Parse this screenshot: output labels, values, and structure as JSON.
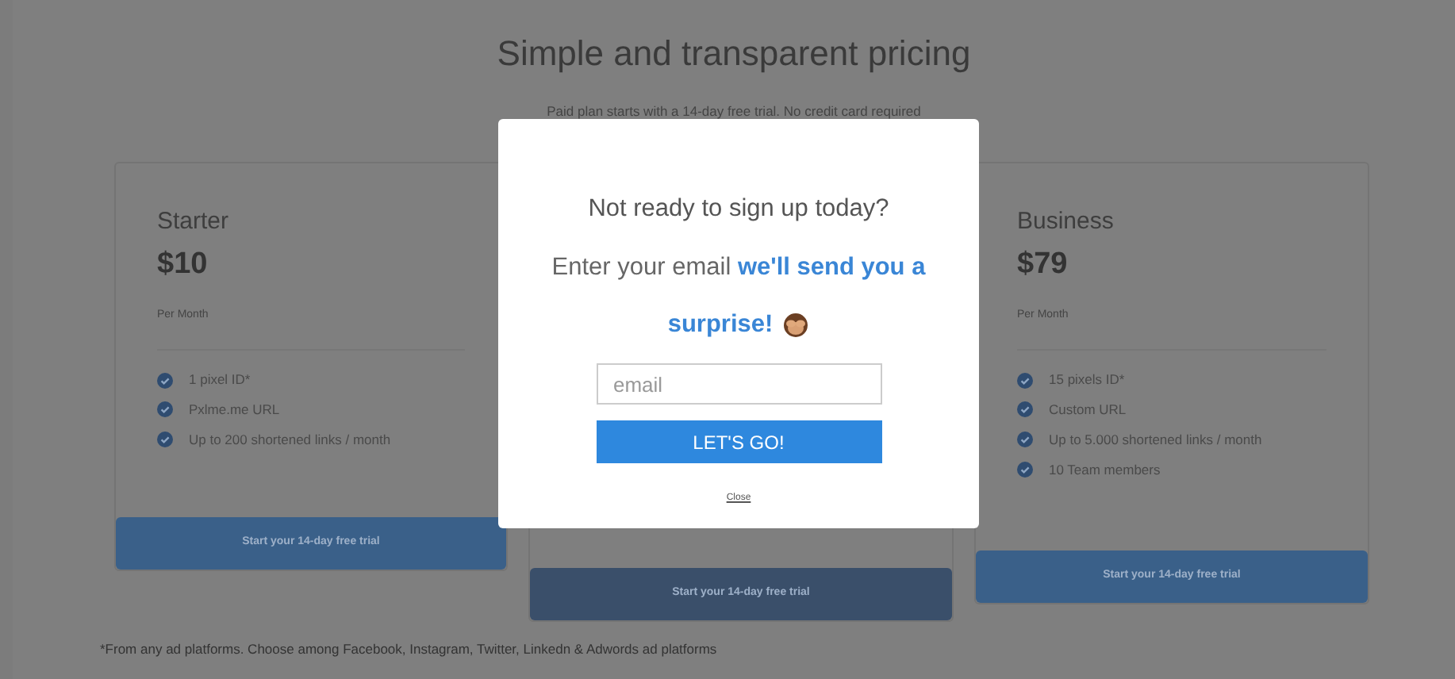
{
  "page": {
    "title": "Simple and transparent pricing",
    "subtitle": "Paid plan starts with a 14-day free trial. No credit card required"
  },
  "plans": [
    {
      "name": "Starter",
      "price": "$10",
      "period": "Per Month",
      "features": [
        "1 pixel ID*",
        "Pxlme.me URL",
        "Up to 200 shortened links / month"
      ],
      "button": "Start your 14-day free trial"
    },
    {
      "button": "Start your 14-day free trial"
    },
    {
      "name": "Business",
      "price": "$79",
      "period": "Per Month",
      "features": [
        "15 pixels ID*",
        "Custom URL",
        "Up to 5.000 shortened links / month",
        "10 Team members"
      ],
      "button": "Start your 14-day free trial"
    }
  ],
  "footnote": "*From any ad platforms. Choose among Facebook, Instagram, Twitter, Linkedn & Adwords ad platforms",
  "modal": {
    "heading": "Not ready to sign up today?",
    "message": [
      "Enter your email **we'll send you a**",
      "**surprise!**"
    ],
    "email": {
      "placeholder": "email"
    },
    "submit": "LET'S GO!",
    "close": "Close"
  }
}
